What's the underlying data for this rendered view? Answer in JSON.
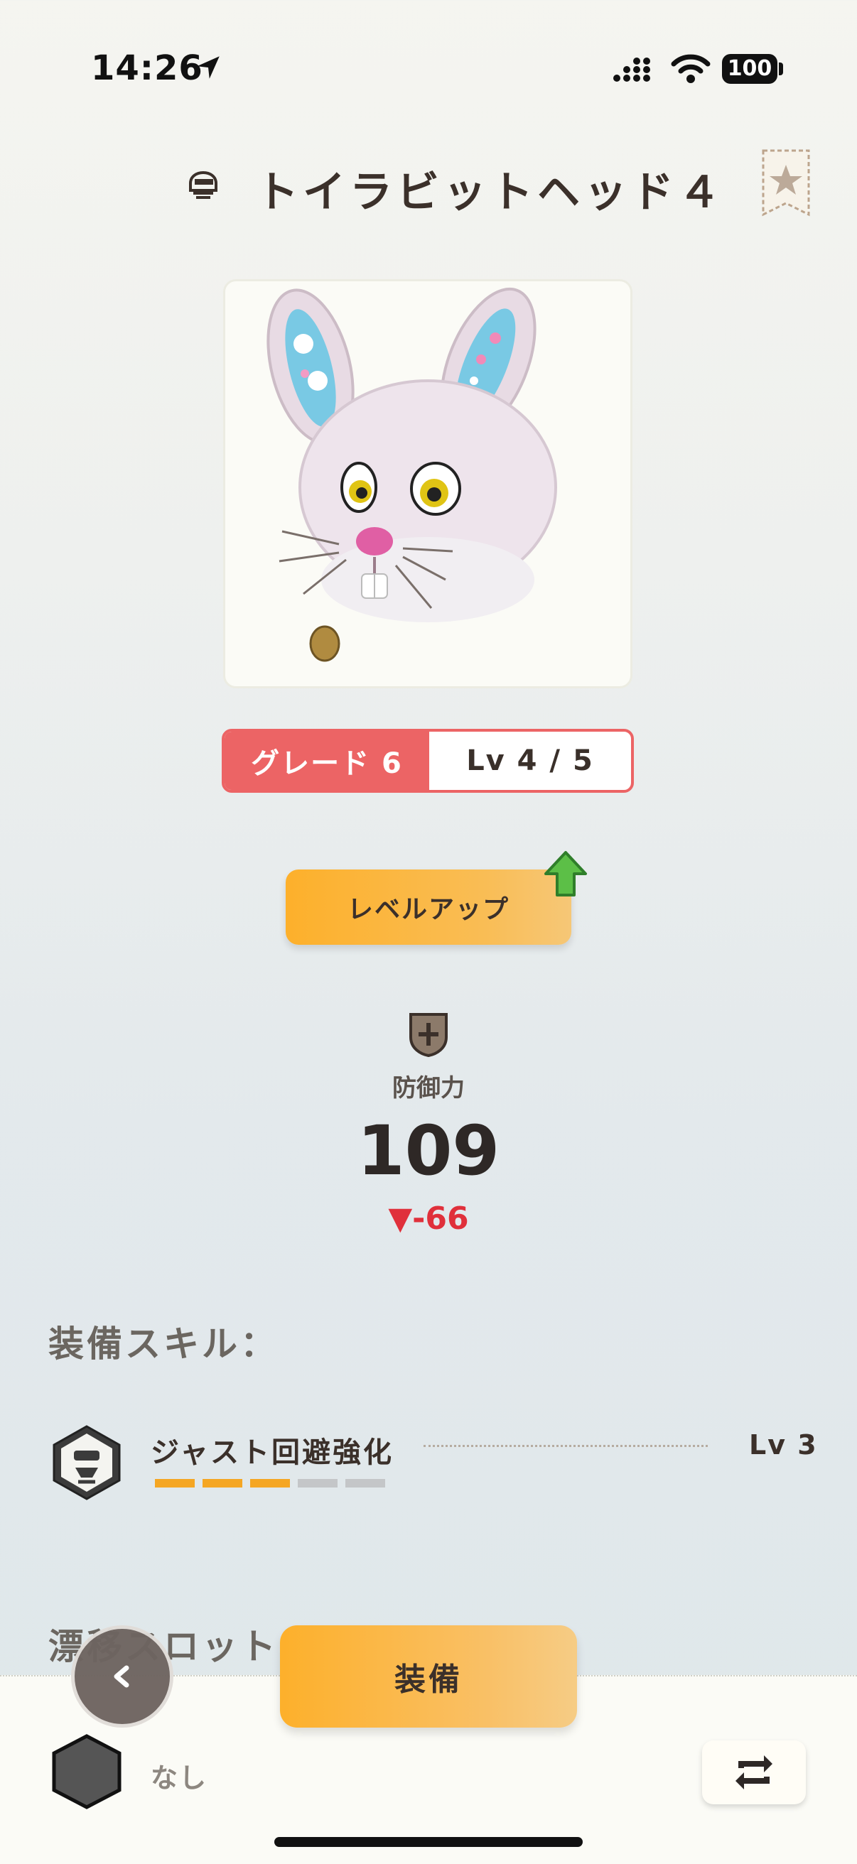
{
  "status": {
    "time": "14:26",
    "battery": "100"
  },
  "header": {
    "title": "トイラビットヘッド４",
    "item_icon": "helmet-icon",
    "favorite_icon": "star-bookmark-icon"
  },
  "item": {
    "grade": "グレード 6",
    "level": "Lv 4 / 5",
    "level_up_label": "レベルアップ",
    "upgrade_available_icon": "green-up-arrow-icon"
  },
  "stats": {
    "defense_label": "防御力",
    "defense_value": "109",
    "defense_diff": "▼-66",
    "defense_icon": "shield-plus-icon"
  },
  "skills": {
    "heading": "装備スキル：",
    "list": [
      {
        "name": "ジャスト回避強化",
        "level": "Lv 3",
        "filled": 3,
        "max": 5
      }
    ]
  },
  "slots": {
    "heading": "漂移スロット:",
    "value": "なし"
  },
  "bottom": {
    "equip_label": "装備",
    "back_icon": "chevron-left-icon",
    "swap_icon": "swap-icon"
  },
  "colors": {
    "accent_orange": "#fdb02b",
    "grade_red": "#ec6465",
    "diff_red": "#e0303b",
    "skill_bar_filled": "#f5a623",
    "skill_bar_empty": "#c4c6c8"
  }
}
